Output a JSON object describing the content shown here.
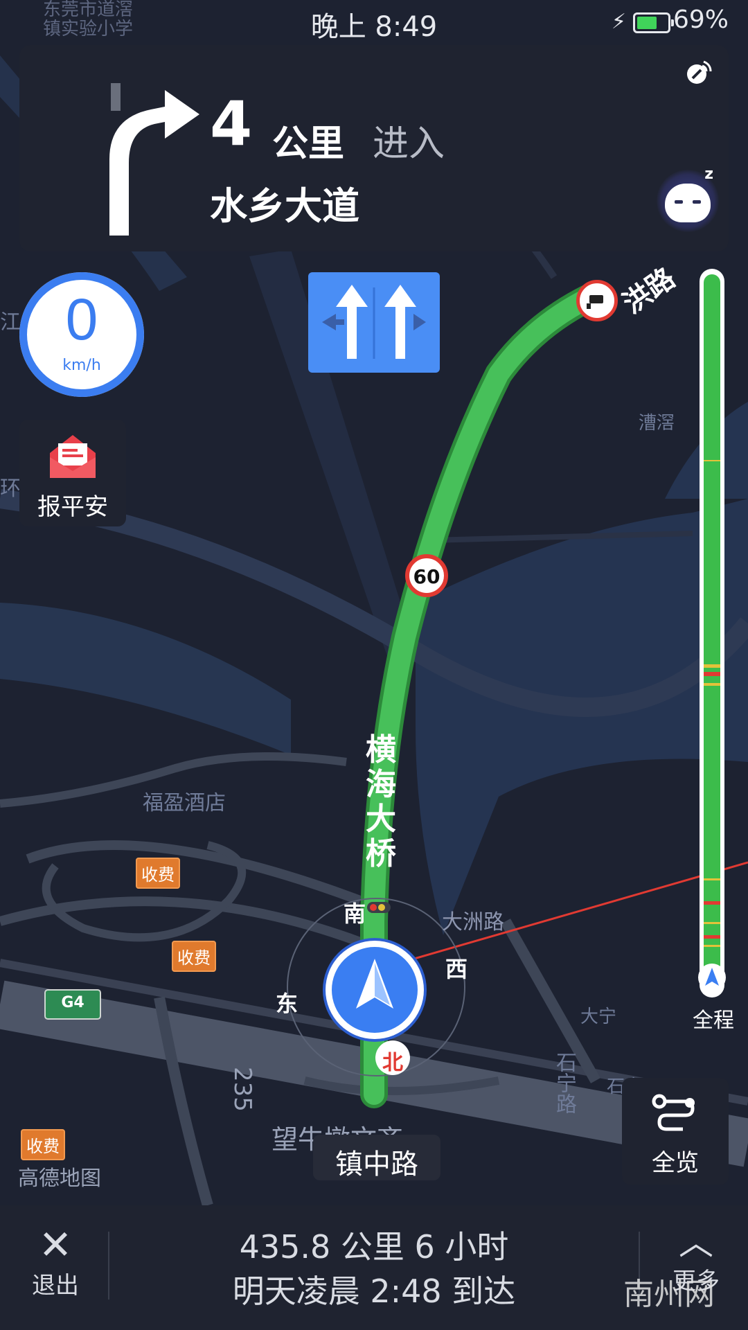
{
  "status_bar": {
    "time": "晚上 8:49",
    "battery_percent": "69%",
    "battery_level": 0.69,
    "charging_icon": "bolt-icon",
    "map_fragment_top_left": "东莞市道滘\n镇实验小学"
  },
  "guidance": {
    "distance_value": "4",
    "distance_unit": "公里",
    "action": "进入",
    "road_name": "水乡大道",
    "turn_icon": "turn-right-arrow-icon",
    "signal_icon": "gps-signal-icon",
    "assistant_icon": "sleeping-robot-icon",
    "assistant_badge": "z"
  },
  "lanes": {
    "icon": "lane-straight-icon",
    "count": 2
  },
  "speedometer": {
    "value": "0",
    "unit": "km/h"
  },
  "safety_button": {
    "label": "报平安",
    "icon": "envelope-icon"
  },
  "route": {
    "road_label": "横海大桥",
    "speed_limit": "60",
    "upcoming_road_fragment": "洪路",
    "camera_icon": "camera-icon"
  },
  "compass": {
    "north": "北",
    "south": "南",
    "east": "东",
    "west": "西"
  },
  "map_labels": {
    "hotel": "福盈酒店",
    "dazhou_road": "大洲路",
    "caoxi": "漕滘",
    "daning": "大宁",
    "shining_road": "石宁路",
    "shining_frag": "石宁",
    "wangniudun": "望牛墩文齐",
    "expressway": "G4",
    "road_235": "235",
    "brand": "高德地图",
    "toll": "收费",
    "left_edge_1": "江",
    "left_edge_2": "环"
  },
  "progress_bar": {
    "label": "全程",
    "traffic_colors": {
      "clear": "#3cbc4b",
      "slow": "#e3c23a",
      "jam": "#e13a32"
    }
  },
  "overview_button": {
    "label": "全览",
    "icon": "route-overview-icon"
  },
  "current_road": "镇中路",
  "bottom_bar": {
    "exit_label": "退出",
    "exit_icon": "close-icon",
    "summary": "435.8 公里  6 小时",
    "eta": "明天凌晨 2:48 到达",
    "more_label": "更多",
    "more_icon": "chevron-up-icon"
  },
  "watermark": "南州网"
}
